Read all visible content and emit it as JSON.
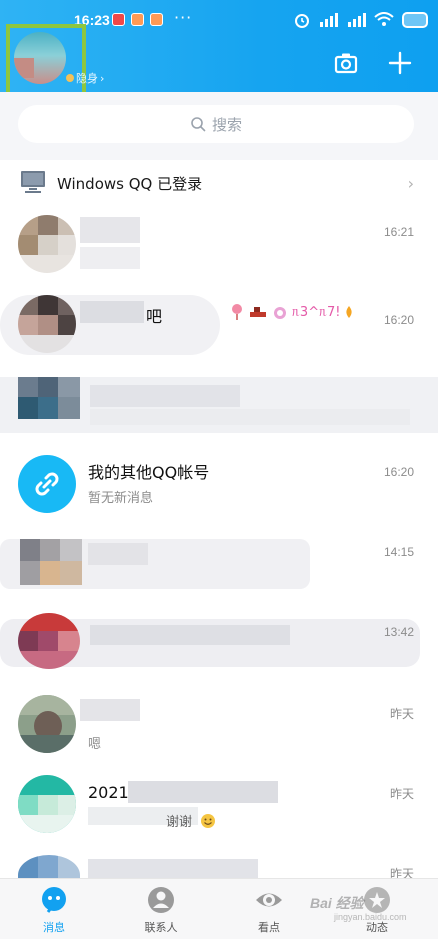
{
  "status_bar": {
    "time": "16:23",
    "dots": "···"
  },
  "profile": {
    "status_label": "隐身"
  },
  "header": {
    "camera_icon": "camera-icon",
    "add_icon": "plus-icon"
  },
  "search": {
    "placeholder": "搜索"
  },
  "windows_login": {
    "label": "Windows QQ 已登录"
  },
  "chats": [
    {
      "title": "",
      "subtitle": "",
      "time": "16:21"
    },
    {
      "title": "吧",
      "subtitle": "",
      "time": "16:20",
      "emoji_text": "ᥰ3^ᥰ7!"
    },
    {
      "title": "",
      "subtitle": "",
      "time": ""
    },
    {
      "title": "我的其他QQ帐号",
      "subtitle": "暂无新消息",
      "time": "16:20"
    },
    {
      "title": "",
      "subtitle": "",
      "time": "14:15"
    },
    {
      "title": "",
      "subtitle": "",
      "time": "13:42"
    },
    {
      "title": "",
      "subtitle": "嗯",
      "time": "昨天"
    },
    {
      "title": "2021",
      "subtitle": "谢谢",
      "time": "昨天"
    },
    {
      "title": "",
      "subtitle": "",
      "time": "昨天"
    }
  ],
  "nav": {
    "messages": "消息",
    "contacts": "联系人",
    "watch": "看点",
    "feed": "动态"
  },
  "watermark": {
    "brand": "Bai 经验",
    "url": "jingyan.baidu.com"
  },
  "colors": {
    "header_blue": "#16a4f0",
    "active_blue": "#12a1f0",
    "frame_green": "#8ec63f"
  }
}
